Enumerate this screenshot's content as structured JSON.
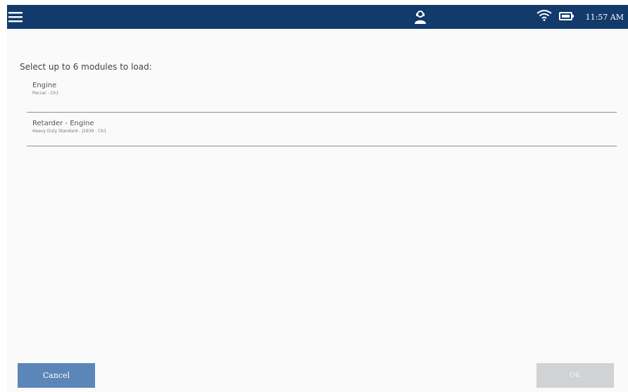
{
  "header": {
    "clock": "11:57 AM",
    "icons": {
      "menu": "hamburger-menu-icon",
      "center": "user-support-icon",
      "wifi": "wifi-icon",
      "battery": "battery-icon"
    },
    "colors": {
      "bar": "#123a6a",
      "icon": "#ffffff"
    }
  },
  "main": {
    "instruction": "Select up to 6 modules to load:",
    "modules": [
      {
        "name": "Engine",
        "sub": "Paccar - Ch1"
      },
      {
        "name": "Retarder - Engine",
        "sub": "Heavy Duty Standard - J1939 - Ch1"
      }
    ]
  },
  "footer": {
    "cancel_label": "Cancel",
    "ok_label": "OK",
    "colors": {
      "cancel": "#5b86b8",
      "ok_disabled": "#d0d2d4"
    }
  }
}
